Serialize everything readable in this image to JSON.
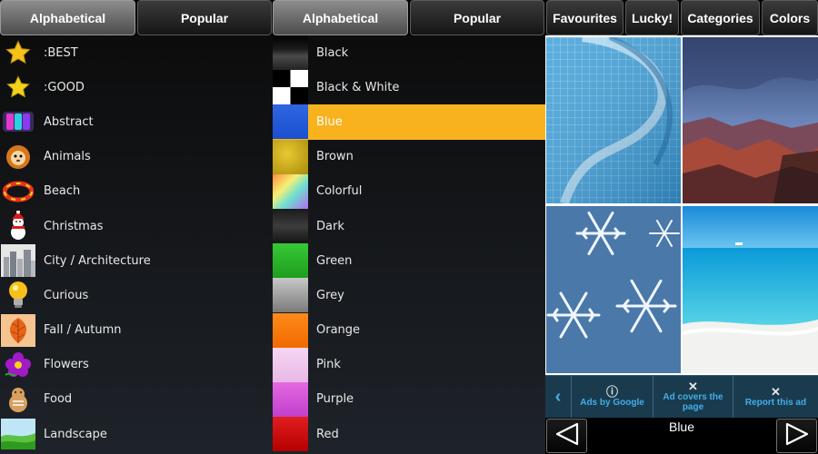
{
  "left_tabs": [
    {
      "label": "Alphabetical",
      "active": true
    },
    {
      "label": "Popular",
      "active": false
    }
  ],
  "mid_tabs": [
    {
      "label": "Alphabetical",
      "active": true
    },
    {
      "label": "Popular",
      "active": false
    }
  ],
  "right_tabs": [
    {
      "label": "Favourites"
    },
    {
      "label": "Lucky!"
    },
    {
      "label": "Categories"
    },
    {
      "label": "Colors"
    }
  ],
  "categories": [
    {
      "label": ":BEST",
      "icon": "star-icon"
    },
    {
      "label": ":GOOD",
      "icon": "star-icon"
    },
    {
      "label": "Abstract",
      "icon": "abstract-icon"
    },
    {
      "label": "Animals",
      "icon": "animal-icon"
    },
    {
      "label": "Beach",
      "icon": "beach-icon"
    },
    {
      "label": "Christmas",
      "icon": "snowman-icon"
    },
    {
      "label": "City / Architecture",
      "icon": "city-icon"
    },
    {
      "label": "Curious",
      "icon": "lightbulb-icon"
    },
    {
      "label": "Fall / Autumn",
      "icon": "leaf-icon"
    },
    {
      "label": "Flowers",
      "icon": "flower-icon"
    },
    {
      "label": "Food",
      "icon": "food-icon"
    },
    {
      "label": "Landscape",
      "icon": "landscape-icon"
    }
  ],
  "colors": [
    {
      "label": "Black",
      "swatch": "linear-gradient(#000,#1c1c1c 40%,#4a4a4a 60%,#222)"
    },
    {
      "label": "Black & White",
      "swatch": "conic-gradient(#fff 0 25%, #000 0 50%, #fff 0 75%, #000 0)"
    },
    {
      "label": "Blue",
      "swatch": "linear-gradient(#2f66e0,#1a4fd0)",
      "selected": true
    },
    {
      "label": "Brown",
      "swatch": "radial-gradient(circle at 40% 40%, #e8c930, #a98a0c)"
    },
    {
      "label": "Colorful",
      "swatch": "linear-gradient(135deg,#ff8a3d,#f6f074 35%,#6fe0d0 60%,#b06cf0)"
    },
    {
      "label": "Dark",
      "swatch": "linear-gradient(#1a1a1a,#3c3c3c 50%,#141414)"
    },
    {
      "label": "Green",
      "swatch": "linear-gradient(#37c837,#1e9e1e)"
    },
    {
      "label": "Grey",
      "swatch": "linear-gradient(#c8c8c8,#7a7a7a)"
    },
    {
      "label": "Orange",
      "swatch": "linear-gradient(#ff8a1a,#f06a00)"
    },
    {
      "label": "Pink",
      "swatch": "linear-gradient(#f6d6f2,#e8b8e6)"
    },
    {
      "label": "Purple",
      "swatch": "linear-gradient(#e26ae0,#c23fcc)"
    },
    {
      "label": "Red",
      "swatch": "linear-gradient(#e01e1e,#b40000)"
    }
  ],
  "ad": {
    "ads_by_google": "Ads by Google",
    "covers_page": "Ad covers the page",
    "report": "Report this ad",
    "info_glyph": "ⓘ",
    "close_glyph": "✕",
    "chevron_glyph": "‹"
  },
  "nav": {
    "current_color": "Blue"
  }
}
